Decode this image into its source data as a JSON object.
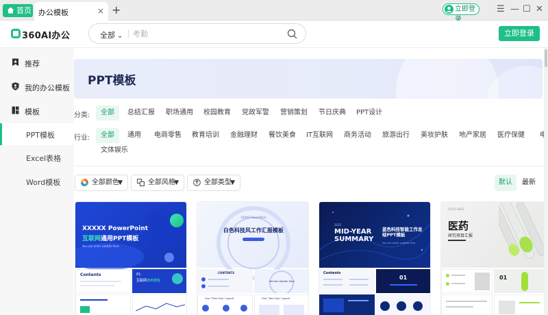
{
  "titlebar": {
    "home_tab": "首页",
    "doc_tab": "办公模板",
    "close_glyph": "×",
    "new_tab_glyph": "+",
    "login_pill": "立即登录",
    "window_controls": [
      "☰",
      "—",
      "☐",
      "✕"
    ]
  },
  "header": {
    "logo_text": "360AI办公",
    "search_scope": "全部",
    "search_placeholder": "考勤",
    "login_button": "立即登录"
  },
  "sidebar": {
    "items": [
      {
        "label": "推荐",
        "icon": "bookmark-icon"
      },
      {
        "label": "我的办公模板",
        "icon": "shield-user-icon"
      },
      {
        "label": "模板",
        "icon": "grid-icon"
      }
    ],
    "sub_items": [
      {
        "label": "PPT模板",
        "active": true
      },
      {
        "label": "Excel表格",
        "active": false
      },
      {
        "label": "Word模板",
        "active": false
      }
    ]
  },
  "main": {
    "banner_title": "PPT模板",
    "category_label": "分类:",
    "categories": [
      "全部",
      "总结汇报",
      "职场通用",
      "校园教育",
      "党政军警",
      "营销策划",
      "节日庆典",
      "PPT设计"
    ],
    "industry_label": "行业:",
    "industries": [
      "全部",
      "通用",
      "电商零售",
      "教育培训",
      "金融理财",
      "餐饮美食",
      "IT互联网",
      "商务活动",
      "旅游出行",
      "美妆护肤",
      "地产家居",
      "医疗保健",
      "电",
      "文体娱乐"
    ],
    "filters": {
      "color": "全部颜色",
      "style": "全部风格",
      "type": "全部类型"
    },
    "sort": {
      "default": "默认",
      "newest": "最新"
    },
    "cards": [
      {
        "cover_line1": "XXXXX PowerPoint",
        "cover_line2a": "互联网",
        "cover_line2b": "通用PPT模板",
        "cover_sub": "You can enter subtitle here",
        "thumb_title": "Contents",
        "thumb_num": "01.",
        "thumb_text": "互联网",
        "thumb_text2": "通用模板"
      },
      {
        "cover_header": "XXXXX PowerPoint",
        "cover_title": "白色科技风工作汇报模板",
        "thumb_title": "CONTENTS",
        "thumb_caption": "Section Header Here",
        "thumb_layout": "One \"Title Only\" Layout",
        "thumb_layout2": "One \"Two Only\" Layout"
      },
      {
        "cover_year": "2025",
        "cover_left": "MID-YEAR\nSUMMARY",
        "cover_right": "蓝色科技智能工作总结PPT模板",
        "cover_sub": "You can enter subtitle here",
        "thumb_title": "Contents",
        "thumb_num": "01"
      },
      {
        "cover_logo": "LOGO HERE",
        "cover_title": "医药",
        "cover_sub": "研究项目汇报",
        "thumb_num": "01"
      }
    ]
  },
  "colors": {
    "accent": "#1fbf86",
    "banner_text": "#1e2a55",
    "card_blue": "#1b3fc7",
    "card_navy": "#0c1a5a"
  }
}
